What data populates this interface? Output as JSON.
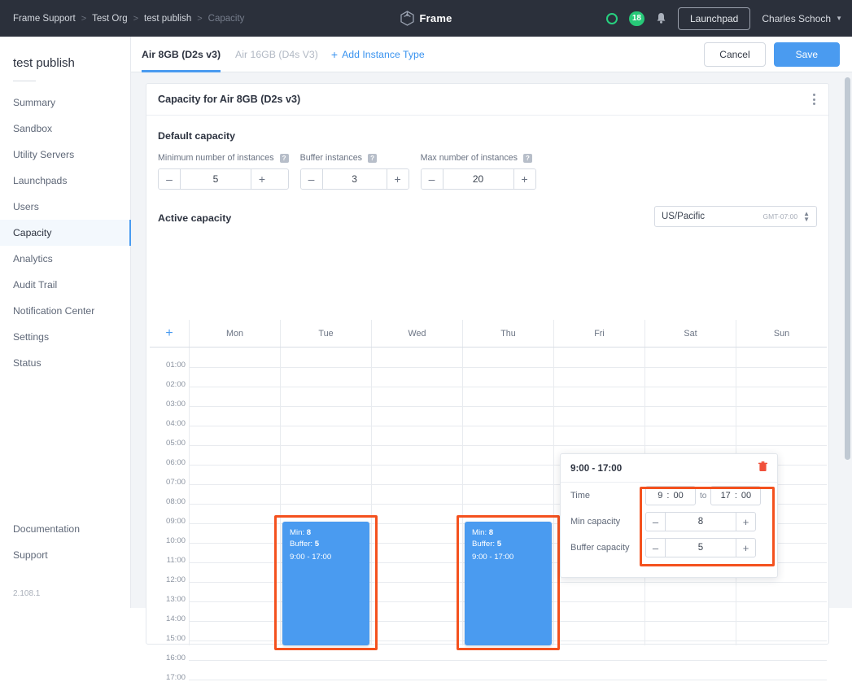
{
  "topbar": {
    "breadcrumb": [
      "Frame Support",
      "Test Org",
      "test publish",
      "Capacity"
    ],
    "separator": ">",
    "brand": "Frame",
    "brand_icon": "cube-icon",
    "status_icon": "status-ring-icon",
    "notification_count": "18",
    "bell_icon": "bell-icon",
    "launchpad_label": "Launchpad",
    "user_name": "Charles Schoch",
    "caret_icon": "chevron-down-icon",
    "accent_green": "#27c878",
    "bar_bg": "#2b303b"
  },
  "sidebar": {
    "title": "test publish",
    "items": [
      "Summary",
      "Sandbox",
      "Utility Servers",
      "Launchpads",
      "Users",
      "Capacity",
      "Analytics",
      "Audit Trail",
      "Notification Center",
      "Settings",
      "Status"
    ],
    "active_index": 5,
    "footer_items": [
      "Documentation",
      "Support"
    ],
    "version": "2.108.1",
    "active_bg": "#f3f8fd",
    "active_accent": "#4a9bf0"
  },
  "tabs": {
    "items": [
      {
        "label": "Air 8GB (D2s v3)",
        "active": true
      },
      {
        "label": "Air 16GB (D4s V3)",
        "active": false
      }
    ],
    "add_label": "Add Instance Type",
    "add_icon": "plus-icon",
    "cancel_label": "Cancel",
    "save_label": "Save",
    "primary_color": "#4a9bf0"
  },
  "card": {
    "title": "Capacity for Air 8GB (D2s v3)",
    "menu_icon": "kebab-menu-icon"
  },
  "default_capacity": {
    "section_title": "Default capacity",
    "help_glyph": "?",
    "minus_glyph": "–",
    "plus_glyph": "+",
    "fields": [
      {
        "label": "Minimum number of instances",
        "value": "5"
      },
      {
        "label": "Buffer instances",
        "value": "3"
      },
      {
        "label": "Max number of instances",
        "value": "20"
      }
    ]
  },
  "active_capacity": {
    "section_title": "Active capacity",
    "timezone": "US/Pacific",
    "gmt_offset": "GMT-07:00",
    "add_icon": "plus-icon",
    "add_column_label": "+",
    "days": [
      "Mon",
      "Tue",
      "Wed",
      "Thu",
      "Fri",
      "Sat",
      "Sun"
    ],
    "hours": [
      "01:00",
      "02:00",
      "03:00",
      "04:00",
      "05:00",
      "06:00",
      "07:00",
      "08:00",
      "09:00",
      "10:00",
      "11:00",
      "12:00",
      "13:00",
      "14:00",
      "15:00",
      "16:00",
      "17:00"
    ],
    "events": [
      {
        "day": "Tue",
        "min_label": "Min:",
        "min_value": "8",
        "buffer_label": "Buffer:",
        "buffer_value": "5",
        "time_range": "9:00 - 17:00",
        "highlighted": true,
        "color": "#4a9bf0"
      },
      {
        "day": "Thu",
        "min_label": "Min:",
        "min_value": "8",
        "buffer_label": "Buffer:",
        "buffer_value": "5",
        "time_range": "9:00 - 17:00",
        "highlighted": true,
        "color": "#4a9bf0"
      }
    ],
    "highlight_color": "#f4511e"
  },
  "popup": {
    "title": "9:00 - 17:00",
    "delete_icon": "trash-icon",
    "time_label": "Time",
    "start_hour": "9",
    "start_minute": "00",
    "colon": ":",
    "to_word": "to",
    "end_hour": "17",
    "end_minute": "00",
    "min_capacity_label": "Min capacity",
    "min_capacity_value": "8",
    "buffer_capacity_label": "Buffer capacity",
    "buffer_capacity_value": "5",
    "minus_glyph": "–",
    "plus_glyph": "+"
  }
}
